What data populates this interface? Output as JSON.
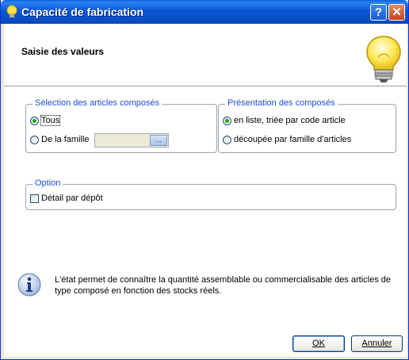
{
  "window": {
    "title": "Capacité de fabrication",
    "help_label": "?",
    "close_label": "✕"
  },
  "header": {
    "title": "Saisie des valeurs"
  },
  "selection_group": {
    "legend": "Sélection des articles composés",
    "options": [
      {
        "label": "Tous",
        "checked": true
      },
      {
        "label": "De la famille",
        "checked": false
      }
    ],
    "family_value": "",
    "browse_label": "..."
  },
  "presentation_group": {
    "legend": "Présentation des composés",
    "options": [
      {
        "label": "en liste, triée par code article",
        "checked": true
      },
      {
        "label": "découpée par famille d'articles",
        "checked": false
      }
    ]
  },
  "option_group": {
    "legend": "Option",
    "checkbox_label": "Détail par dépôt",
    "checked": false
  },
  "info": {
    "text": "L'état permet de connaître la quantité assemblable ou commercialisable des articles de type composé en fonction des stocks réels."
  },
  "buttons": {
    "ok_label": "OK",
    "cancel_label": "Annuler"
  },
  "colors": {
    "titlebar": "#0A4FC8",
    "legend_text": "#1F4ECB",
    "radio_dot": "#21A121"
  }
}
